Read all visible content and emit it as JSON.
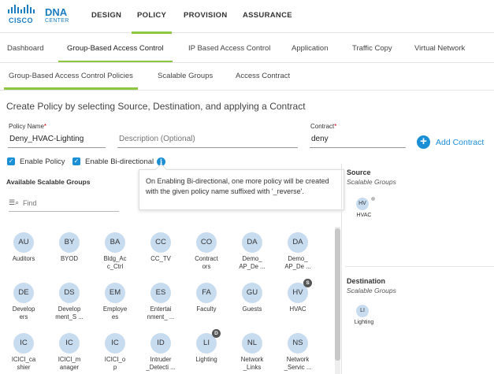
{
  "brand": {
    "company": "CISCO",
    "product": "DNA",
    "product_sub": "CENTER",
    "accent": "#8dc63f",
    "primary": "#1a8fd6"
  },
  "topnav": [
    {
      "label": "DESIGN",
      "active": false
    },
    {
      "label": "POLICY",
      "active": true
    },
    {
      "label": "PROVISION",
      "active": false
    },
    {
      "label": "ASSURANCE",
      "active": false
    }
  ],
  "subtabs": [
    {
      "label": "Dashboard",
      "active": false
    },
    {
      "label": "Group-Based Access Control",
      "active": true
    },
    {
      "label": "IP Based Access Control",
      "active": false
    },
    {
      "label": "Application",
      "active": false
    },
    {
      "label": "Traffic Copy",
      "active": false
    },
    {
      "label": "Virtual Network",
      "active": false
    }
  ],
  "tertabs": [
    {
      "label": "Group-Based Access Control Policies",
      "active": true
    },
    {
      "label": "Scalable Groups",
      "active": false
    },
    {
      "label": "Access Contract",
      "active": false
    }
  ],
  "form": {
    "title": "Create Policy by selecting Source, Destination, and applying a Contract",
    "policy_name_label": "Policy Name",
    "required_mark": "*",
    "policy_name_value": "Deny_HVAC-Lighting",
    "description_placeholder": "Description (Optional)",
    "contract_label": "Contract",
    "contract_value": "deny",
    "add_contract_label": "Add Contract",
    "enable_policy_label": "Enable Policy",
    "enable_policy_checked": true,
    "enable_bidir_label": "Enable Bi-directional",
    "enable_bidir_checked": true
  },
  "tooltip": {
    "text": "On Enabling Bi-directional, one more policy will be created with the given policy name suffixed with '_reverse'."
  },
  "available": {
    "title": "Available Scalable Groups",
    "search_placeholder": "Find",
    "groups": [
      {
        "abbr": "AU",
        "name": "Auditors",
        "badge": ""
      },
      {
        "abbr": "BY",
        "name": "BYOD",
        "badge": ""
      },
      {
        "abbr": "BA",
        "name": "Bldg_Ac\nc_Ctrl",
        "badge": ""
      },
      {
        "abbr": "CC",
        "name": "CC_TV",
        "badge": ""
      },
      {
        "abbr": "CO",
        "name": "Contract\nors",
        "badge": ""
      },
      {
        "abbr": "DA",
        "name": "Demo_\nAP_De ...",
        "badge": ""
      },
      {
        "abbr": "DA",
        "name": "Demo_\nAP_De ...",
        "badge": ""
      },
      {
        "abbr": "DE",
        "name": "Develop\ners",
        "badge": ""
      },
      {
        "abbr": "DS",
        "name": "Develop\nment_S ...",
        "badge": ""
      },
      {
        "abbr": "EM",
        "name": "Employe\nes",
        "badge": ""
      },
      {
        "abbr": "ES",
        "name": "Entertai\nnment_ ...",
        "badge": ""
      },
      {
        "abbr": "FA",
        "name": "Faculty",
        "badge": ""
      },
      {
        "abbr": "GU",
        "name": "Guests",
        "badge": ""
      },
      {
        "abbr": "HV",
        "name": "HVAC",
        "badge": "S"
      },
      {
        "abbr": "IC",
        "name": "ICICI_ca\nshier",
        "badge": ""
      },
      {
        "abbr": "IC",
        "name": "ICICI_m\nanager",
        "badge": ""
      },
      {
        "abbr": "IC",
        "name": "ICICI_o\np",
        "badge": ""
      },
      {
        "abbr": "ID",
        "name": "Intruder\n_Detecti ...",
        "badge": ""
      },
      {
        "abbr": "LI",
        "name": "Lighting",
        "badge": "D"
      },
      {
        "abbr": "NL",
        "name": "Network\n_Links",
        "badge": ""
      },
      {
        "abbr": "NS",
        "name": "Network\n_Servic ...",
        "badge": ""
      }
    ]
  },
  "source": {
    "title": "Source",
    "subtitle": "Scalable Groups",
    "selected": {
      "abbr": "HV",
      "name": "HVAC"
    }
  },
  "destination": {
    "title": "Destination",
    "subtitle": "Scalable Groups",
    "selected": {
      "abbr": "LI",
      "name": "Lighting"
    }
  }
}
